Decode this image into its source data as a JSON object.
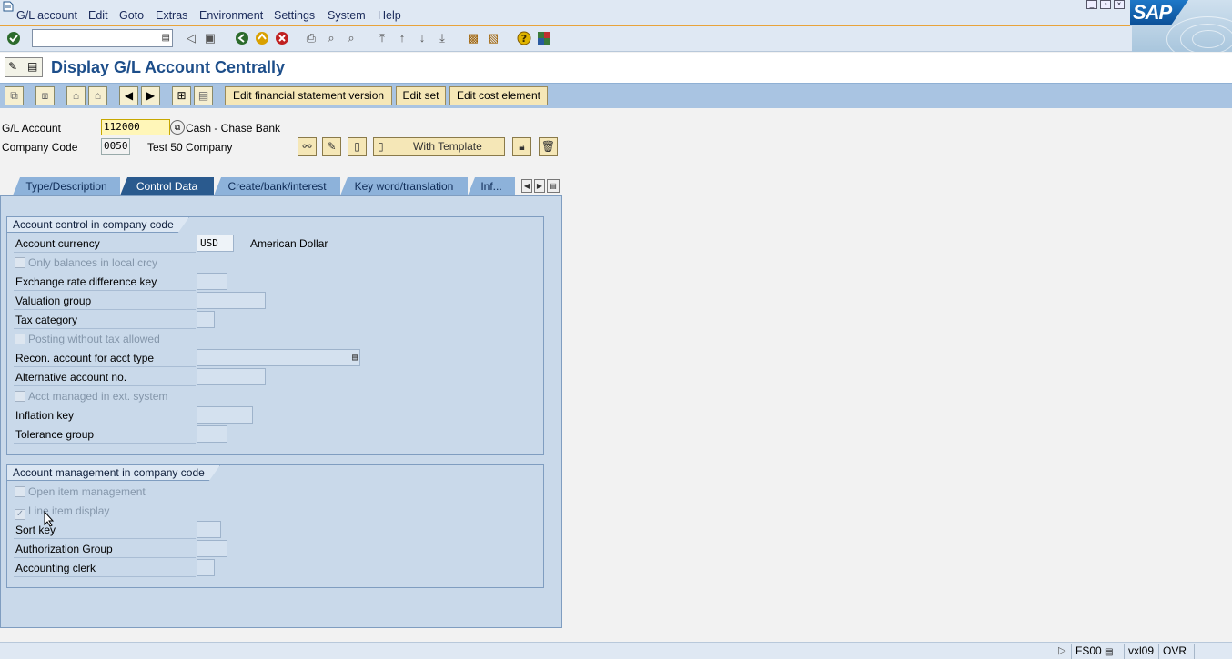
{
  "menu": {
    "items": [
      "G/L account",
      "Edit",
      "Goto",
      "Extras",
      "Environment",
      "Settings",
      "System",
      "Help"
    ]
  },
  "logo": {
    "text": "SAP"
  },
  "title": "Display G/L Account Centrally",
  "app_toolbar": {
    "edit_fsv_label": "Edit financial statement version",
    "edit_set_label": "Edit set",
    "edit_cost_element_label": "Edit cost element"
  },
  "header": {
    "gl_account_label": "G/L Account",
    "gl_account_value": "112000",
    "gl_account_desc": "Cash - Chase Bank",
    "company_code_label": "Company Code",
    "company_code_value": "0050",
    "company_code_desc": "Test 50 Company",
    "with_template_label": "With Template"
  },
  "tabs": [
    {
      "label": "Type/Description",
      "active": false
    },
    {
      "label": "Control Data",
      "active": true
    },
    {
      "label": "Create/bank/interest",
      "active": false
    },
    {
      "label": "Key word/translation",
      "active": false
    },
    {
      "label": "Inf...",
      "active": false
    }
  ],
  "group1": {
    "title": "Account control in company code",
    "account_currency_label": "Account currency",
    "account_currency_value": "USD",
    "account_currency_desc": "American Dollar",
    "only_balances_label": "Only balances in local crcy",
    "exchange_rate_key_label": "Exchange rate difference key",
    "valuation_group_label": "Valuation group",
    "tax_category_label": "Tax category",
    "posting_without_tax_label": "Posting without tax allowed",
    "recon_account_label": "Recon. account for acct type",
    "alt_account_label": "Alternative account no.",
    "acct_managed_ext_label": "Acct managed in ext. system",
    "inflation_key_label": "Inflation key",
    "tolerance_group_label": "Tolerance group"
  },
  "group2": {
    "title": "Account management in company code",
    "open_item_label": "Open item management",
    "line_item_label": "Line item display",
    "line_item_checked": true,
    "sort_key_label": "Sort key",
    "auth_group_label": "Authorization Group",
    "accounting_clerk_label": "Accounting clerk"
  },
  "status": {
    "transaction": "FS00",
    "server": "vxl09",
    "mode": "OVR"
  },
  "colors": {
    "title": "#1d4e8a",
    "active_tab": "#2a5a8e",
    "button_bg": "#f5e7b7",
    "menu_accent": "#e8a33a"
  }
}
